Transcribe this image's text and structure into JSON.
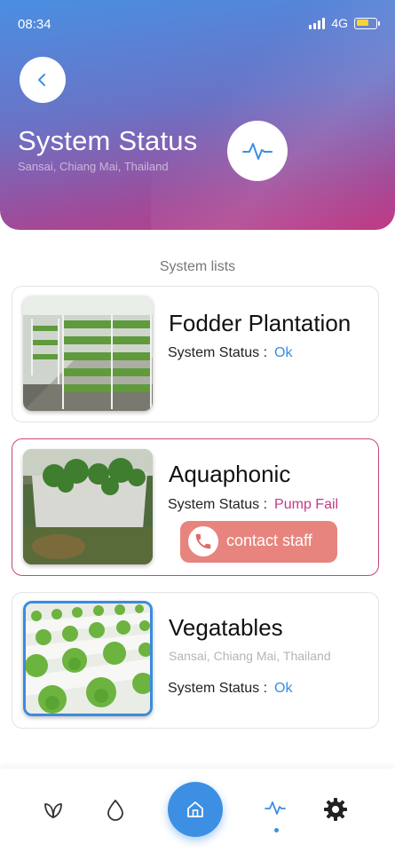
{
  "status_bar": {
    "time": "08:34",
    "network": "4G"
  },
  "header": {
    "title": "System Status",
    "subtitle": "Sansai, Chiang Mai, Thailand",
    "back_icon": "chevron-left-icon",
    "badge_icon": "activity-pulse-icon"
  },
  "section_label": "System lists",
  "systems": [
    {
      "title": "Fodder Plantation",
      "status_label": "System Status :",
      "status_value": "Ok",
      "image": "fodder-shelves-photo"
    },
    {
      "title": "Aquaphonic",
      "status_label": "System Status :",
      "status_value": "Pump Fail",
      "image": "aquaponic-tank-photo",
      "action_label": "contact staff"
    },
    {
      "title": "Vegatables",
      "location": "Sansai, Chiang Mai, Thailand",
      "status_label": "System Status :",
      "status_value": "Ok",
      "image": "hydroponic-lettuce-photo"
    }
  ],
  "nav": {
    "items": [
      "leaf-icon",
      "water-drop-icon",
      "home-icon",
      "activity-pulse-icon",
      "gear-icon"
    ],
    "active": "activity-pulse-icon"
  },
  "colors": {
    "accent": "#3d8fe3",
    "alert": "#c23a86",
    "contact_button": "#e8847e",
    "header_gradient_top": "#4a8fe2",
    "header_gradient_bottom": "#c03b86"
  }
}
